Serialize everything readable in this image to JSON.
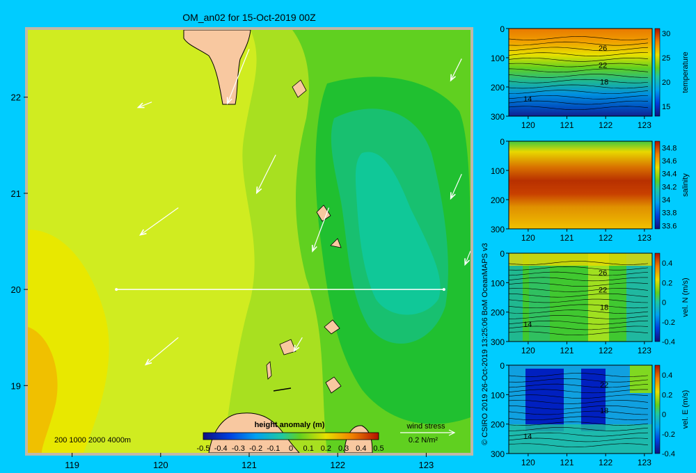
{
  "title": "OM_an02 for 15-Oct-2019 00Z",
  "credit": "© CSIRO 2019   26-Oct-2019 13:25:06 BoM OceanMAPS v3",
  "depth_legend": "200  1000  2000  4000m",
  "colors": {
    "background": "#00ccff",
    "land": "#f8c8a0",
    "frame": "#c0b8a8"
  },
  "colorbar": {
    "label": "height anomaly  (m)",
    "ticks": [
      "-0.5",
      "-0.4",
      "-0.3",
      "-0.2",
      "-0.1",
      "0",
      "0.1",
      "0.2",
      "0.3",
      "0.4",
      "0.5"
    ]
  },
  "wind_legend": {
    "title": "wind stress",
    "value_label": "0.2 N/m²"
  },
  "chart_data": [
    {
      "type": "heatmap",
      "name": "height anomaly map",
      "x_ticks": [
        "119",
        "120",
        "121",
        "122",
        "123"
      ],
      "y_ticks": [
        "22",
        "21",
        "20",
        "19"
      ],
      "xlim": [
        118.5,
        123.5
      ],
      "ylim": [
        18.3,
        22.7
      ],
      "section_line": {
        "lat": 20.0,
        "lon_start": 119.5,
        "lon_end": 123.2
      },
      "field_levels": [
        {
          "value": 0.3,
          "note": "southwest region"
        },
        {
          "value": 0.2,
          "note": "west/central"
        },
        {
          "value": 0.15,
          "note": "central shelf"
        },
        {
          "value": 0.1,
          "note": "east of 121"
        },
        {
          "value": 0.05,
          "note": "eastern deep"
        },
        {
          "value": 0.0,
          "note": "eddy core 122.3E 20.5N"
        }
      ],
      "wind_vectors": [
        {
          "lon": 119.9,
          "lat": 21.95,
          "u": -0.05,
          "v": -0.02
        },
        {
          "lon": 120.2,
          "lat": 20.85,
          "u": -0.14,
          "v": -0.1
        },
        {
          "lon": 120.2,
          "lat": 19.5,
          "u": -0.12,
          "v": -0.1
        },
        {
          "lon": 121.0,
          "lat": 22.5,
          "u": -0.08,
          "v": -0.2
        },
        {
          "lon": 121.3,
          "lat": 21.4,
          "u": -0.07,
          "v": -0.14
        },
        {
          "lon": 121.9,
          "lat": 20.85,
          "u": -0.06,
          "v": -0.16
        },
        {
          "lon": 121.6,
          "lat": 19.5,
          "u": -0.03,
          "v": -0.05
        },
        {
          "lon": 123.4,
          "lat": 22.4,
          "u": -0.04,
          "v": -0.08
        },
        {
          "lon": 123.4,
          "lat": 21.2,
          "u": -0.04,
          "v": -0.09
        },
        {
          "lon": 123.5,
          "lat": 20.4,
          "u": -0.02,
          "v": -0.05
        }
      ]
    },
    {
      "type": "heatmap",
      "name": "temperature section",
      "cbar_label": "temperature",
      "x_ticks": [
        "120",
        "121",
        "122",
        "123"
      ],
      "y_ticks": [
        "0",
        "100",
        "200",
        "300"
      ],
      "cbar_ticks": [
        "30",
        "25",
        "20",
        "15"
      ],
      "xlim": [
        119.5,
        123.2
      ],
      "ylim": [
        0,
        300
      ],
      "contour_labels": [
        "26",
        "22",
        "18",
        "14"
      ],
      "profile": [
        [
          0,
          29.5
        ],
        [
          40,
          28.5
        ],
        [
          70,
          26
        ],
        [
          100,
          23.5
        ],
        [
          140,
          21
        ],
        [
          180,
          19
        ],
        [
          220,
          17
        ],
        [
          260,
          15
        ],
        [
          300,
          13.5
        ]
      ]
    },
    {
      "type": "heatmap",
      "name": "salinity section",
      "cbar_label": "salinity",
      "x_ticks": [
        "120",
        "121",
        "122",
        "123"
      ],
      "y_ticks": [
        "0",
        "100",
        "200",
        "300"
      ],
      "cbar_ticks": [
        "34.8",
        "34.6",
        "34.4",
        "34.2",
        "34",
        "33.8",
        "33.6"
      ],
      "xlim": [
        119.5,
        123.2
      ],
      "ylim": [
        0,
        300
      ],
      "profile": [
        [
          0,
          34.2
        ],
        [
          40,
          34.45
        ],
        [
          80,
          34.68
        ],
        [
          120,
          34.72
        ],
        [
          160,
          34.65
        ],
        [
          200,
          34.55
        ],
        [
          240,
          34.5
        ],
        [
          300,
          34.45
        ]
      ]
    },
    {
      "type": "heatmap",
      "name": "northward velocity section",
      "cbar_label": "vel. N (m/s)",
      "x_ticks": [
        "120",
        "121",
        "122",
        "123"
      ],
      "y_ticks": [
        "0",
        "100",
        "200",
        "300"
      ],
      "cbar_ticks": [
        "0.4",
        "0.2",
        "0",
        "-0.2",
        "-0.4"
      ],
      "xlim": [
        119.5,
        123.2
      ],
      "ylim": [
        0,
        300
      ],
      "contour_labels": [
        "26",
        "22",
        "18",
        "14"
      ]
    },
    {
      "type": "heatmap",
      "name": "eastward velocity section",
      "cbar_label": "vel. E (m/s)",
      "x_ticks": [
        "120",
        "121",
        "122",
        "123"
      ],
      "y_ticks": [
        "0",
        "100",
        "200",
        "300"
      ],
      "cbar_ticks": [
        "0.4",
        "0.2",
        "0",
        "-0.2",
        "-0.4"
      ],
      "xlim": [
        119.5,
        123.2
      ],
      "ylim": [
        0,
        300
      ],
      "contour_labels": [
        "22",
        "18",
        "14"
      ]
    }
  ]
}
